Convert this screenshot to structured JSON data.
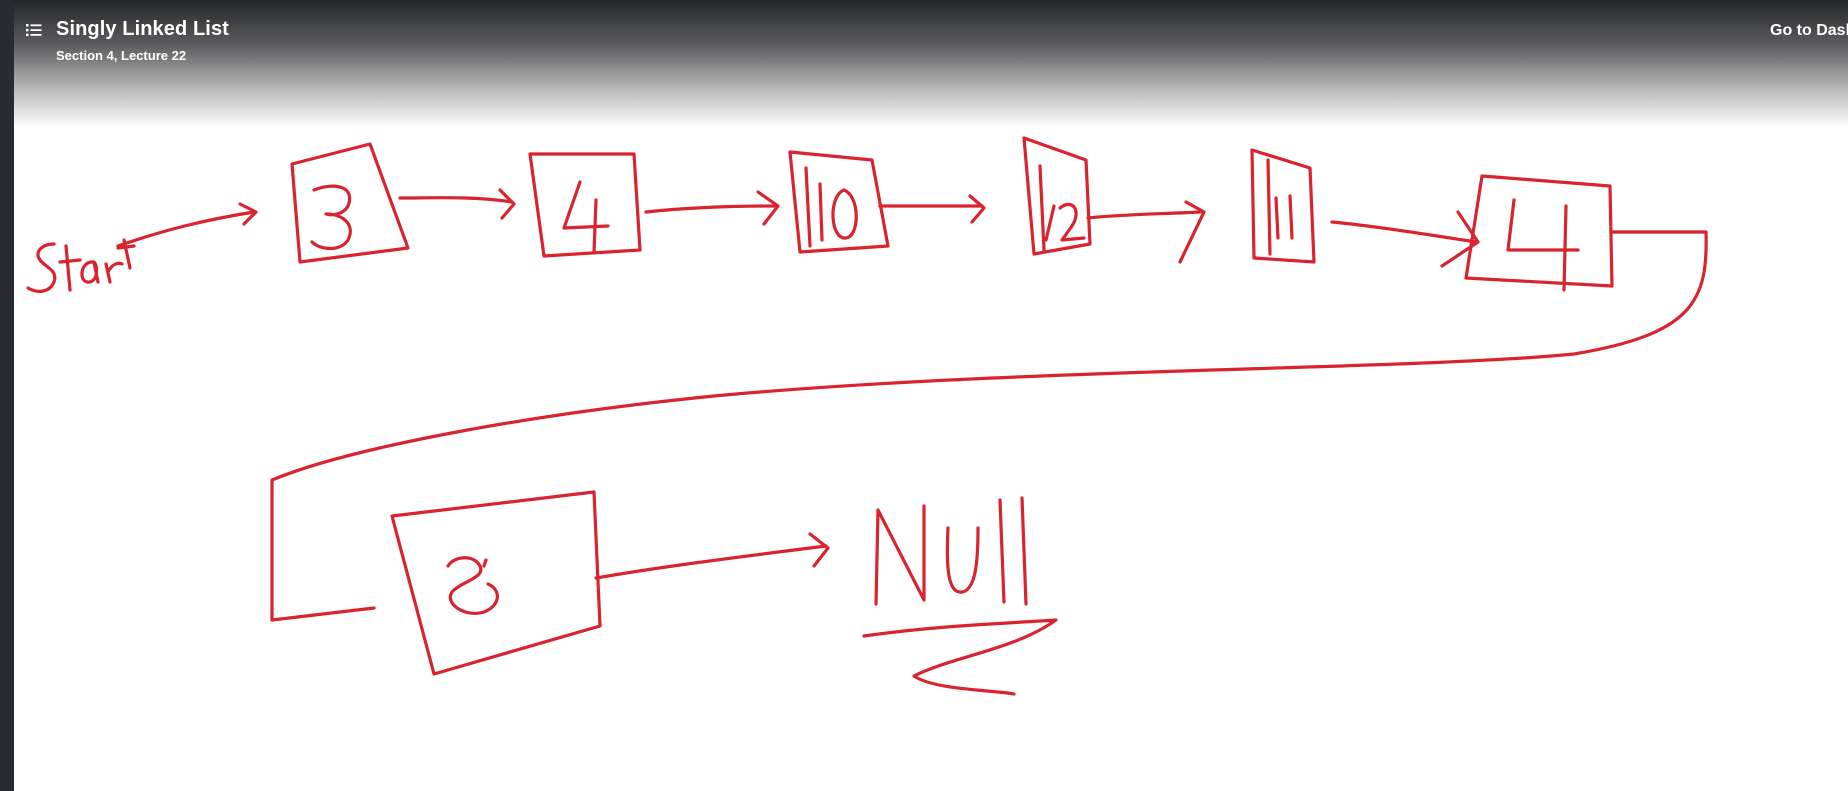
{
  "header": {
    "title": "Singly Linked List",
    "subtitle": "Section 4, Lecture 22",
    "dashboard_link": "Go to Dash"
  },
  "icons": {
    "menu": "list-icon"
  },
  "colors": {
    "ink": "#d9232e",
    "header_gradient": "#1c1d1f",
    "left_edge": "#2a2b30"
  },
  "diagram": {
    "start_label": "start",
    "nodes": [
      "3",
      "4",
      "10",
      "12",
      "11",
      "4",
      "5"
    ],
    "terminal": "Null"
  }
}
